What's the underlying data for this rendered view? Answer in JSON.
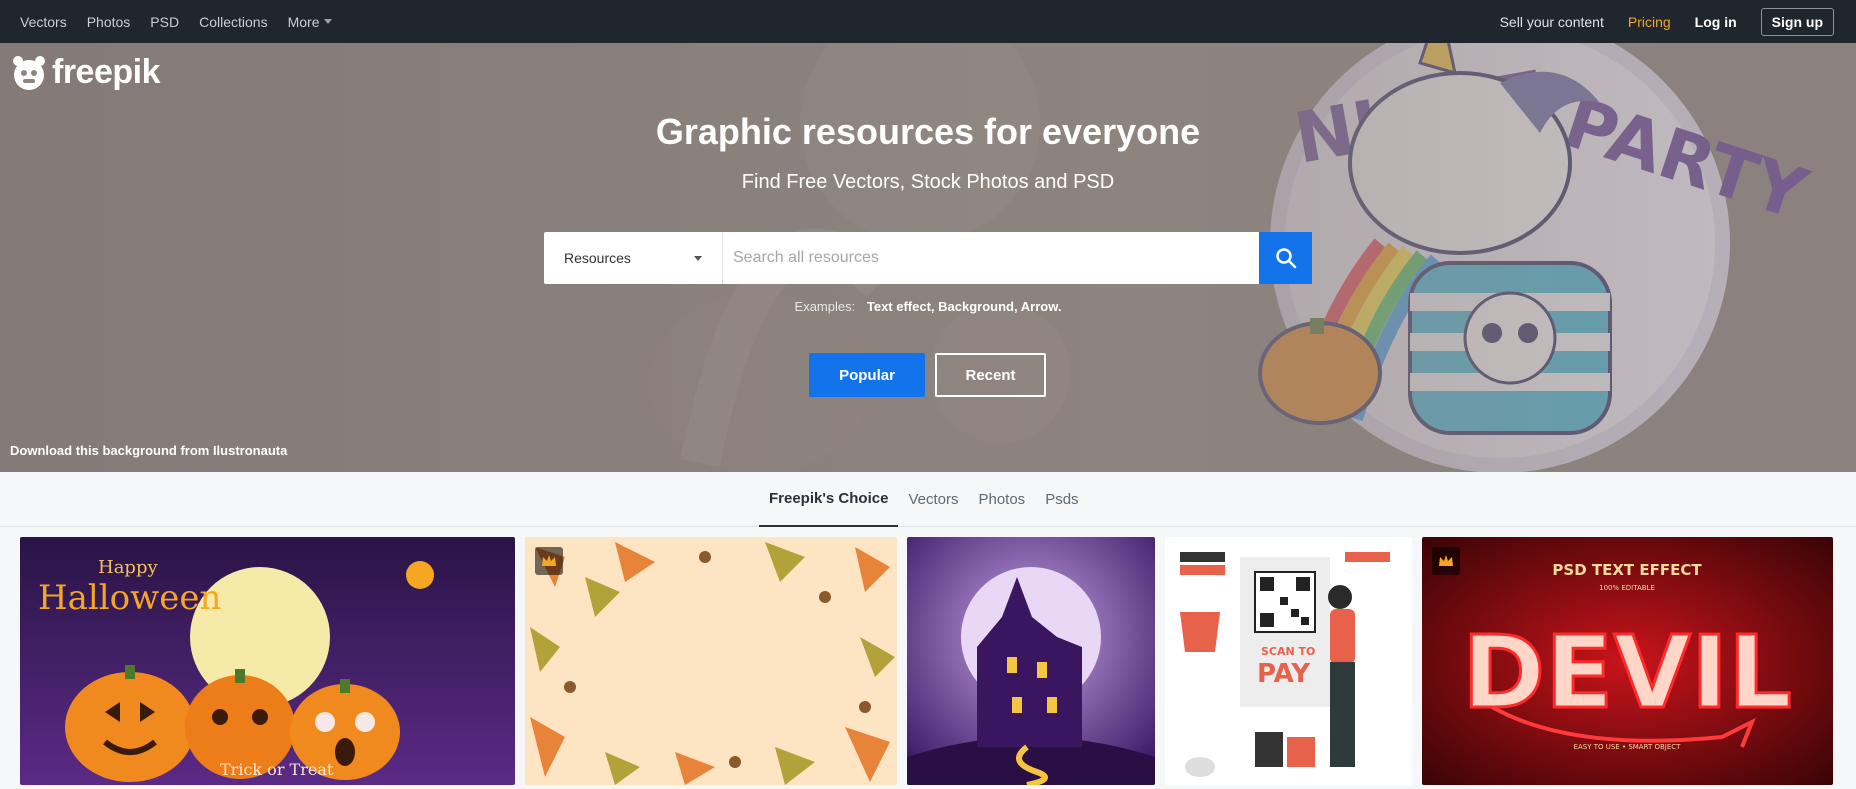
{
  "nav": {
    "left": [
      "Vectors",
      "Photos",
      "PSD",
      "Collections"
    ],
    "more": "More",
    "sell": "Sell your content",
    "pricing": "Pricing",
    "login": "Log in",
    "signup": "Sign up"
  },
  "hero": {
    "logo_text": "freepik",
    "title": "Graphic resources for everyone",
    "subtitle": "Find Free Vectors, Stock Photos and PSD",
    "search_type": "Resources",
    "search_placeholder": "Search all resources",
    "examples_label": "Examples:",
    "examples": [
      "Text effect",
      "Background",
      "Arrow"
    ],
    "popular_btn": "Popular",
    "recent_btn": "Recent",
    "credit": "Download this background from Ilustronauta",
    "background_text": "NIGHT PARTY"
  },
  "tabs": [
    "Freepik's Choice",
    "Vectors",
    "Photos",
    "Psds"
  ],
  "active_tab": 0,
  "cards": [
    {
      "name": "halloween-pumpkins",
      "premium": false,
      "text_top": "Happy",
      "text_main": "Halloween",
      "text_bottom": "Trick or Treat"
    },
    {
      "name": "autumn-leaves",
      "premium": true
    },
    {
      "name": "haunted-house",
      "premium": false
    },
    {
      "name": "scan-to-pay",
      "premium": false,
      "text_top": "SCAN TO",
      "text_main": "PAY"
    },
    {
      "name": "devil-text-effect",
      "premium": true,
      "text_top": "PSD TEXT EFFECT",
      "text_sub": "100% EDITABLE",
      "text_main": "DEVIL",
      "text_bottom": "EASY TO USE • SMART OBJECT"
    }
  ],
  "colors": {
    "nav_bg": "#1f262e",
    "accent": "#1273eb",
    "pricing": "#f5a623"
  }
}
